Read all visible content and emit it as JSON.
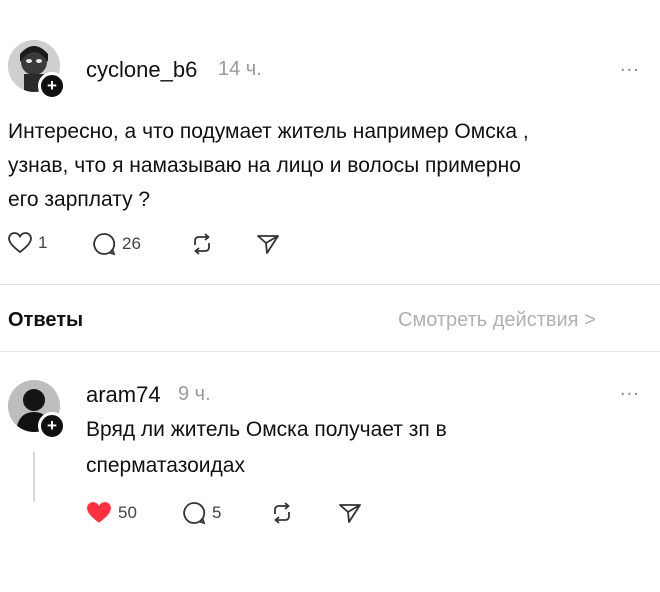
{
  "post": {
    "username": "cyclone_b6",
    "time": "14 ч.",
    "more": "...",
    "text": "Интересно, а что подумает житель например Омска ,\nузнав,  что я намазываю на лицо и волосы примерно\nего зарплату ?",
    "likes": "1",
    "comments": "26"
  },
  "replies_header": {
    "title": "Ответы",
    "view_activity": "Смотреть действия >"
  },
  "reply": {
    "username": "aram74",
    "time": "9 ч.",
    "more": "...",
    "text": "Вряд ли житель Омска получает зп в\nсперматазоидах",
    "likes": "50",
    "comments": "5",
    "liked": true
  },
  "colors": {
    "like_active": "#ff3040",
    "muted": "#9a9a9a"
  }
}
